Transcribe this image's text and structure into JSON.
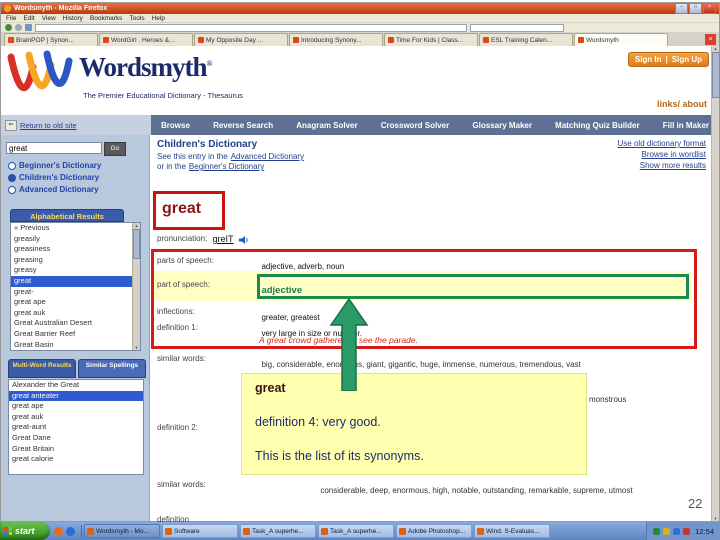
{
  "window": {
    "title": "Wordsmyth - Mozilla Firefox",
    "menu": [
      "File",
      "Edit",
      "View",
      "History",
      "Bookmarks",
      "Tools",
      "Help"
    ],
    "tabs": [
      "BrainPOP | Synon...",
      "WordGirl . Heroes &...",
      "My Opposite Day ...",
      "Introducing Synony...",
      "Time For Kids | Class...",
      "ESL Training Calen...",
      "Wordsmyth"
    ],
    "active_tab": 6
  },
  "site": {
    "brand": "Wordsmyth",
    "tagline": "The Premier Educational Dictionary - Thesaurus",
    "sign_in": "Sign In",
    "sign_up": "Sign Up",
    "links_about": "links/ about",
    "return_old_site": "Return to old site",
    "nav": [
      "Browse",
      "Reverse Search",
      "Anagram Solver",
      "Crossword Solver",
      "Glossary Maker",
      "Matching Quiz Builder",
      "Fill in Maker"
    ]
  },
  "sidebar": {
    "search_value": "great",
    "go_label": "Go",
    "dictionaries": [
      "Beginner's Dictionary",
      "Children's Dictionary",
      "Advanced Dictionary"
    ],
    "active_dictionary": 1,
    "alpha_tab": "Alphabetical Results",
    "alpha_items": [
      "« Previous",
      "greasily",
      "greasiness",
      "greasing",
      "greasy",
      "great",
      "great-",
      "great ape",
      "great auk",
      "Great Australian Desert",
      "Great Barrier Reef",
      "Great Basin"
    ],
    "alpha_active": 5,
    "multi_tab": "Multi-Word Results",
    "similar_tab": "Similar Spellings",
    "multi_items": [
      "Alexander the Great",
      "great anteater",
      "great ape",
      "great auk",
      "great-aunt",
      "Great Dane",
      "Great Britain",
      "great calorie"
    ],
    "multi_active": 1
  },
  "entry": {
    "dictionary_heading": "Children's Dictionary",
    "see_entry_prefix": "See this entry in the",
    "see_entry_link": "Advanced Dictionary",
    "see_entry_line2_prefix": "or in the",
    "see_entry_line2_link": "Beginner's Dictionary",
    "right_links": [
      "Use old dictionary format",
      "Browse in wordlist",
      "Show more results"
    ],
    "headword": "great",
    "pronunciation_label": "pronunciation:",
    "pronunciation": "greIT",
    "parts_label": "parts of speech:",
    "parts_value": "adjective, adverb, noun",
    "pos_label": "part of speech:",
    "pos_value": "adjective",
    "inflections_label": "inflections:",
    "inflections_value": "greater, greatest",
    "def1_label": "definition 1:",
    "def1_value": "very large in size or number.",
    "def1_example": "A great crowd gathered to see the parade.",
    "similar1_label": "similar words:",
    "similar1_value": "big, considerable, enormous, giant, gigantic, huge, immense, numerous, tremendous, vast",
    "def2_label": "definition 2:",
    "partial_word": "monstrous",
    "similar2_label": "similar words:",
    "similar2_value": "considerable, deep, enormous, high, notable, outstanding, remarkable, supreme, utmost",
    "bottom_partial": "definition"
  },
  "callout": {
    "word": "great",
    "line1": "definition 4: very good.",
    "line2": "This is the list of its synonyms."
  },
  "slide": {
    "page_number": "22"
  },
  "taskbar": {
    "start_label": "start",
    "buttons": [
      "Wordsmyth - Mo...",
      "Software",
      "Task_A superhe...",
      "Task_A superhe...",
      "Adobe Photoshop...",
      "Wind. S-Evaluas..."
    ],
    "active_button": 0,
    "clock": "12:54"
  },
  "icons": {
    "minimize": "─",
    "maximize": "□",
    "close": "×",
    "tab_close": "×",
    "scroll_up": "▲",
    "scroll_down": "▼",
    "return_arrow": "⇐"
  },
  "colors": {
    "annotation_red": "#d61a1a",
    "annotation_green": "#1c8a58",
    "callout_yellow": "#ffffb0",
    "highlight_yellow": "#ffffc4",
    "brand_navy": "#1b2a6b",
    "accent_orange": "#e07d1e"
  }
}
